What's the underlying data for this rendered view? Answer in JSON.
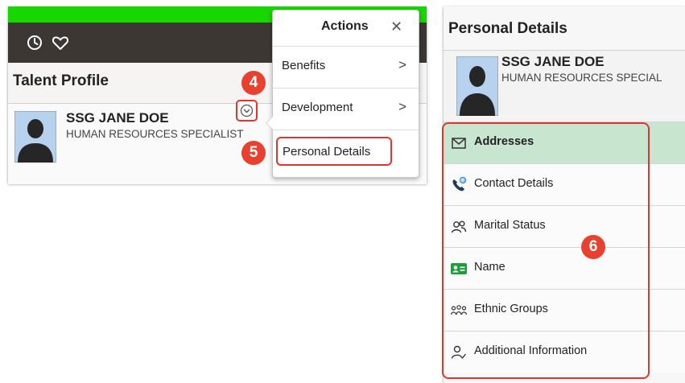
{
  "talent_profile": {
    "title": "Talent Profile",
    "employee_name": "SSG JANE DOE",
    "job_title": "HUMAN RESOURCES SPECIALIST",
    "top_icons": [
      "history-icon",
      "heart-icon"
    ]
  },
  "actions_menu": {
    "title": "Actions",
    "close_symbol": "✕",
    "items": [
      {
        "label": "Benefits",
        "has_submenu": true
      },
      {
        "label": "Development",
        "has_submenu": true
      },
      {
        "label": "Personal Details",
        "has_submenu": false
      }
    ],
    "chevron_symbol": ">"
  },
  "personal_details": {
    "title": "Personal Details",
    "employee_name": "SSG JANE DOE",
    "job_title": "HUMAN RESOURCES SPECIAL",
    "nav_items": [
      {
        "label": "Addresses",
        "icon": "envelope-icon",
        "active": true
      },
      {
        "label": "Contact Details",
        "icon": "phone-icon",
        "active": false
      },
      {
        "label": "Marital Status",
        "icon": "people-icon",
        "active": false
      },
      {
        "label": "Name",
        "icon": "id-card-icon",
        "active": false
      },
      {
        "label": "Ethnic Groups",
        "icon": "group-icon",
        "active": false
      },
      {
        "label": "Additional Information",
        "icon": "person-check-icon",
        "active": false
      }
    ]
  },
  "callouts": {
    "step4": "4",
    "step5": "5",
    "step6": "6"
  },
  "colors": {
    "accent_green": "#18d600",
    "header_dark": "#3c3733",
    "callout_red": "#e8412f",
    "active_row": "#c8e6cf",
    "avatar_bg": "#b7d2ee"
  }
}
